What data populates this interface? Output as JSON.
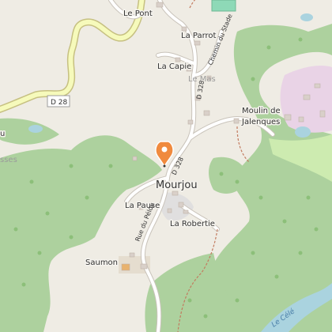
{
  "colors": {
    "land": "#efece4",
    "forest": "#add19e",
    "forest_dark": "#9cc68a",
    "meadow": "#cdebb0",
    "water": "#aad3df",
    "residential": "#e0dfdf",
    "landuse_purple": "#e9d3e6",
    "primary_road": "#f6fabb",
    "primary_casing": "#c6c081",
    "minor_road": "#ffffff",
    "road_casing": "#c9c3ba",
    "building": "#d9d0c9",
    "marker": "#f08a3e",
    "sports": "#8ed9b7"
  },
  "places": {
    "le_pont": "Le Pont",
    "la_parrot": "La Parrot",
    "la_capie": "La Capie",
    "le_mas": "Le Mas",
    "moulin": "Moulin de",
    "moulin_2": "Jalenques",
    "mourjou": "Mourjou",
    "la_pause": "La Pause",
    "la_robertie": "La Robertie",
    "saumon": "Saumon",
    "left_edge_1": "u",
    "left_edge_2": "sses"
  },
  "roads": {
    "d28": "D 28",
    "d328_a": "D 328",
    "d328_b": "D 328",
    "chemin_stade": "Chemin du Stade",
    "rue_pelou": "Rue du Pélou"
  },
  "water": {
    "river": "Le Célé"
  },
  "marker": {
    "icon": "map-pin-icon",
    "color": "#f08a3e"
  }
}
